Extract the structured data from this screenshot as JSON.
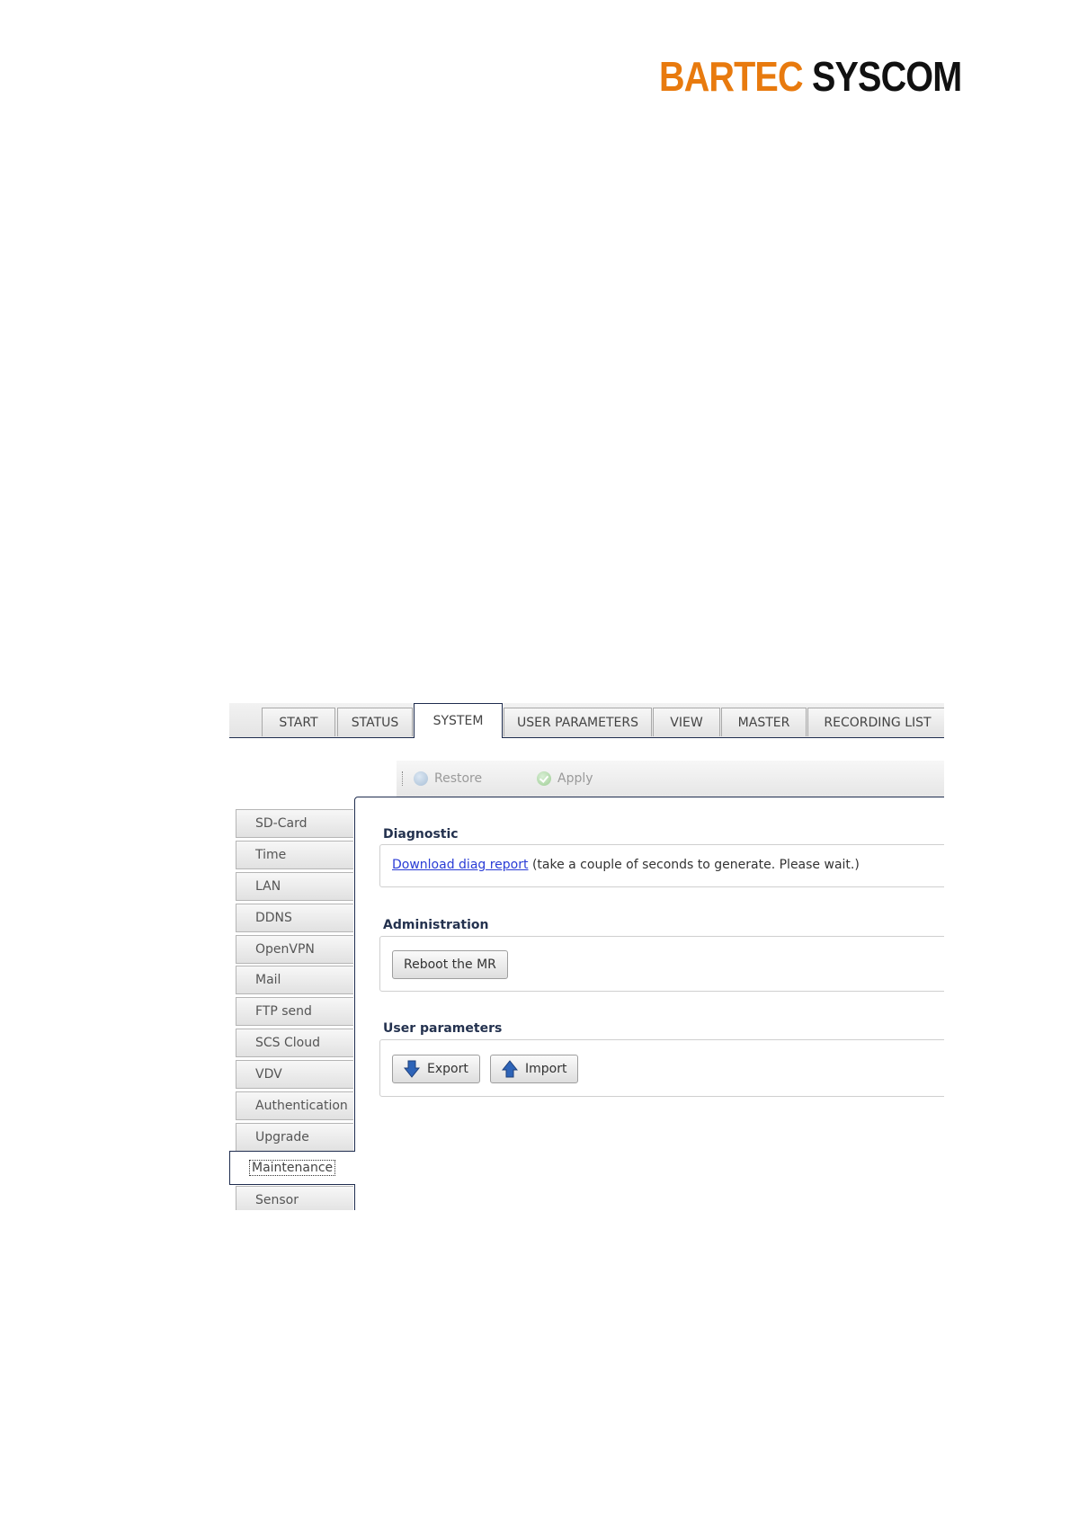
{
  "brand": {
    "word1": "BARTEC",
    "word2": "SYSCOM",
    "color1": "#e87a0e",
    "color2": "#111111"
  },
  "tabs": [
    {
      "label": "START",
      "active": false
    },
    {
      "label": "STATUS",
      "active": false
    },
    {
      "label": "SYSTEM",
      "active": true
    },
    {
      "label": "USER PARAMETERS",
      "active": false
    },
    {
      "label": "VIEW",
      "active": false
    },
    {
      "label": "MASTER",
      "active": false
    },
    {
      "label": "RECORDING LIST",
      "active": false
    }
  ],
  "toolbar": {
    "restore_label": "Restore",
    "restore_icon": "restore-icon",
    "apply_label": "Apply",
    "apply_icon": "check-icon"
  },
  "sidebar": {
    "items": [
      {
        "label": "SD-Card"
      },
      {
        "label": "Time"
      },
      {
        "label": "LAN"
      },
      {
        "label": "DDNS"
      },
      {
        "label": "OpenVPN"
      },
      {
        "label": "Mail"
      },
      {
        "label": "FTP send"
      },
      {
        "label": "SCS Cloud"
      },
      {
        "label": "VDV"
      },
      {
        "label": "Authentication"
      },
      {
        "label": "Upgrade"
      },
      {
        "label": "Maintenance",
        "active": true
      },
      {
        "label": "Sensor"
      }
    ]
  },
  "main": {
    "diagnostic": {
      "title": "Diagnostic",
      "link_label": "Download diag report",
      "note": "(take a couple of seconds to generate. Please wait.)"
    },
    "administration": {
      "title": "Administration",
      "reboot_label": "Reboot the MR"
    },
    "user_parameters": {
      "title": "User parameters",
      "export_label": "Export",
      "export_icon": "arrow-down-icon",
      "import_label": "Import",
      "import_icon": "arrow-up-icon"
    }
  },
  "colors": {
    "active_border": "#1f2d4f",
    "section_title": "#24324f",
    "link": "#2a3cd6",
    "arrow": "#2e64b8"
  }
}
